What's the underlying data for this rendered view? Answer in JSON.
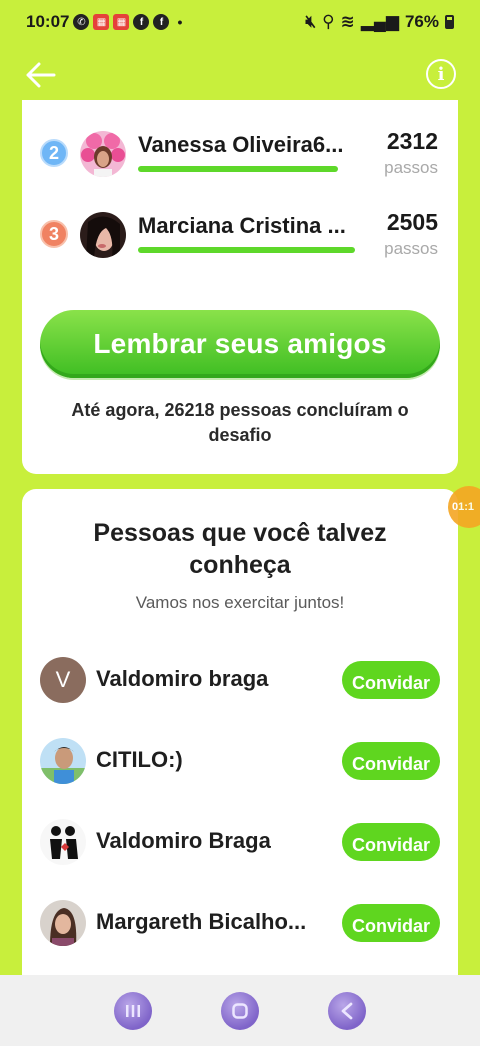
{
  "status_bar": {
    "time": "10:07",
    "battery": "76%"
  },
  "leaderboard": [
    {
      "rank": "2",
      "name": "Vanessa Oliveira6...",
      "steps": "2312",
      "unit": "passos",
      "progress": 0.83
    },
    {
      "rank": "3",
      "name": "Marciana Cristina ...",
      "steps": "2505",
      "unit": "passos",
      "progress": 0.9
    }
  ],
  "remind_button": "Lembrar seus amigos",
  "completed_text": "Até agora, 26218 pessoas concluíram o desafio",
  "timer_badge": "01:1",
  "people_section": {
    "title": "Pessoas que você talvez conheça",
    "subtitle": "Vamos nos exercitar juntos!",
    "invite_label": "Convidar",
    "people": [
      {
        "name": "Valdomiro braga",
        "avatar_letter": "V"
      },
      {
        "name": "CITILO:)"
      },
      {
        "name": "Valdomiro Braga"
      },
      {
        "name": "Margareth Bicalho..."
      }
    ]
  },
  "colors": {
    "background": "#c8ef3c",
    "accent_green": "#5fd61f",
    "rank2_badge": "#6fb6f6",
    "rank3_badge": "#f08262"
  }
}
